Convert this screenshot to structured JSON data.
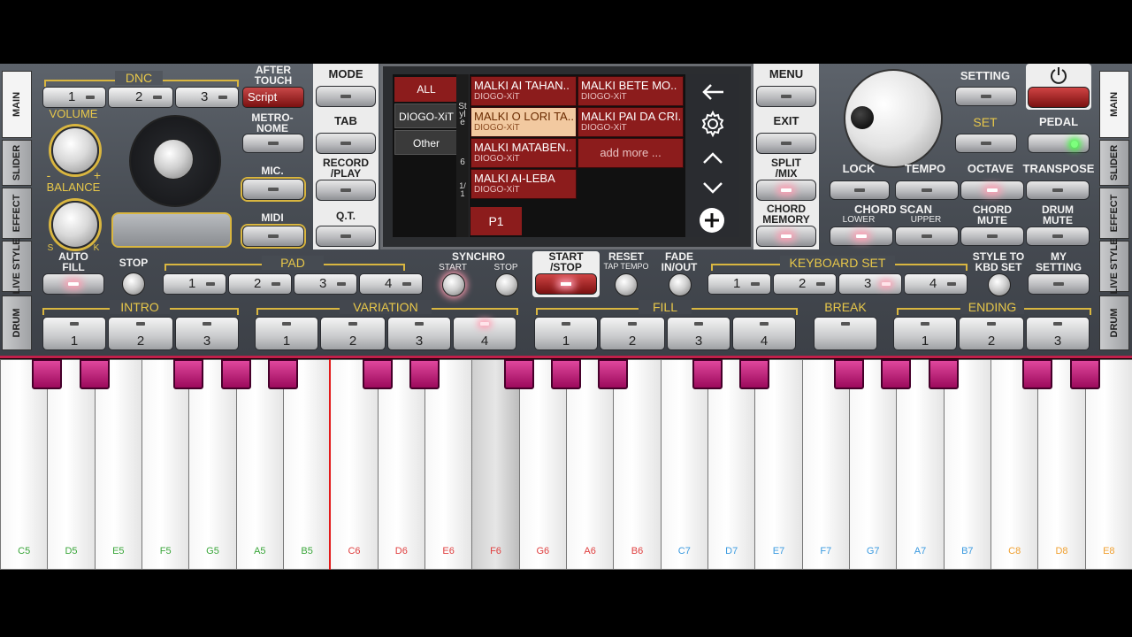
{
  "top_left": {
    "dnc_label": "DNC",
    "after_touch_label": "AFTER\nTOUCH",
    "dnc_buttons": [
      "1",
      "2",
      "3"
    ],
    "script_button": "Script",
    "volume_label": "VOLUME",
    "minus": "-",
    "plus": "+",
    "balance_label": "BALANCE",
    "s_label": "S",
    "k_label": "K",
    "metronome_label": "METRO-\nNOME",
    "mic_label": "MIC.",
    "midi_label": "MIDI"
  },
  "center_left": {
    "mode": "MODE",
    "tab": "TAB",
    "record_play": "RECORD\n/PLAY",
    "qt": "Q.T."
  },
  "screen": {
    "filters": [
      "ALL",
      "DIOGO-XiT",
      "Other"
    ],
    "side_text": [
      "Style",
      "6",
      "1/1"
    ],
    "styles": [
      {
        "name": "MALKI AI TAHAN..",
        "author": "DIOGO-XiT"
      },
      {
        "name": "MALKI BETE MO..",
        "author": "DIOGO-XiT"
      },
      {
        "name": "MALKI O LORI TA..",
        "author": "DIOGO-XiT"
      },
      {
        "name": "MALKI PAI DA CRI..",
        "author": "DIOGO-XiT"
      },
      {
        "name": "MALKI MATABEN..",
        "author": "DIOGO-XiT"
      },
      {
        "name": "add more ...",
        "author": ""
      },
      {
        "name": "MALKI AI-LEBA",
        "author": "DIOGO-XiT"
      }
    ],
    "page": "P1"
  },
  "center_right": {
    "menu": "MENU",
    "exit": "EXIT",
    "split_mix": "SPLIT\n/MIX",
    "chord_memory": "CHORD\nMEMORY"
  },
  "top_right": {
    "setting": "SETTING",
    "set": "SET",
    "pedal": "PEDAL",
    "lock": "LOCK",
    "tempo": "TEMPO",
    "octave": "OCTAVE",
    "transpose": "TRANSPOSE",
    "chord_scan": "CHORD SCAN",
    "lower": "LOWER",
    "upper": "UPPER",
    "chord_mute": "CHORD\nMUTE",
    "drum_mute": "DRUM\nMUTE"
  },
  "side_tabs_left": [
    "MAIN",
    "SLIDER",
    "EFFECT",
    "LIVE STYLE",
    "DRUM"
  ],
  "side_tabs_right": [
    "MAIN",
    "SLIDER",
    "EFFECT",
    "LIVE STYLE",
    "DRUM"
  ],
  "row3": {
    "auto_fill": "AUTO\nFILL",
    "stop": "STOP",
    "pad": "PAD",
    "pad_buttons": [
      "1",
      "2",
      "3",
      "4"
    ],
    "synchro": "SYNCHRO",
    "start": "START",
    "stop2": "STOP",
    "start_stop": "START\n/STOP",
    "reset": "RESET",
    "tap_tempo": "TAP TEMPO",
    "fade": "FADE\nIN/OUT",
    "keyboard_set": "KEYBOARD SET",
    "kbd_buttons": [
      "1",
      "2",
      "3",
      "4"
    ],
    "style_to_kbd": "STYLE TO\nKBD SET",
    "my_setting": "MY\nSETTING"
  },
  "row4": {
    "intro": "INTRO",
    "intro_buttons": [
      "1",
      "2",
      "3"
    ],
    "variation": "VARIATION",
    "variation_buttons": [
      "1",
      "2",
      "3",
      "4"
    ],
    "fill": "FILL",
    "fill_buttons": [
      "1",
      "2",
      "3",
      "4"
    ],
    "break": "BREAK",
    "ending": "ENDING",
    "ending_buttons": [
      "1",
      "2",
      "3"
    ]
  },
  "keyboard": {
    "white_keys": [
      "C5",
      "D5",
      "E5",
      "F5",
      "G5",
      "A5",
      "B5",
      "C6",
      "D6",
      "E6",
      "F6",
      "G6",
      "A6",
      "B6",
      "C7",
      "D7",
      "E7",
      "F7",
      "G7",
      "A7",
      "B7",
      "C8",
      "D8",
      "E8"
    ],
    "key_colors": {
      "5": "#3aa63a",
      "6": "#e04040",
      "7": "#3a9ae0",
      "8": "#f0a030"
    }
  }
}
